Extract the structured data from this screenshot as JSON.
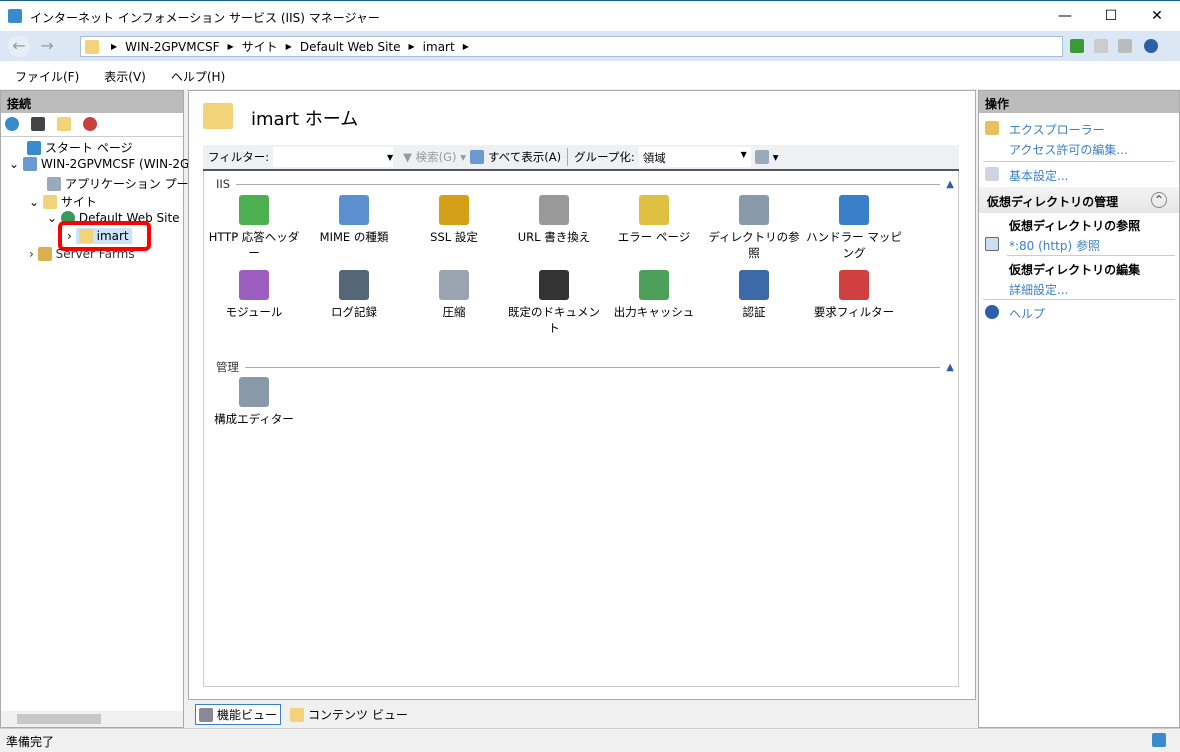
{
  "window": {
    "title": "インターネット インフォメーション サービス (IIS) マネージャー",
    "minimize": "—",
    "maximize": "☐",
    "close": "✕"
  },
  "address": {
    "crumbs": [
      "WIN-2GPVMCSF",
      "サイト",
      "Default Web Site",
      "imart"
    ],
    "back": "←",
    "forward": "→"
  },
  "menu": [
    "ファイル(F)",
    "表示(V)",
    "ヘルプ(H)"
  ],
  "connections": {
    "title": "接続",
    "tree": [
      "スタート ページ",
      "WIN-2GPVMCSF (WIN-2G",
      "アプリケーション プール",
      "サイト",
      "Default Web Site",
      "imart",
      "Server Farms"
    ],
    "selected": "imart"
  },
  "main": {
    "title": "imart ホーム",
    "filter_label": "フィルター:",
    "filter_value": "",
    "search": "検索(G)",
    "show_all": "すべて表示(A)",
    "group_label": "グループ化:",
    "group_value": "領域",
    "sections": [
      {
        "name": "IIS",
        "features": [
          {
            "label": "HTTP 応答ヘッダー",
            "icon": "http-headers-icon",
            "color": "#4caf50"
          },
          {
            "label": "MIME の種類",
            "icon": "mime-types-icon",
            "color": "#5b8fd0"
          },
          {
            "label": "SSL 設定",
            "icon": "lock-icon",
            "color": "#d4a017"
          },
          {
            "label": "URL 書き換え",
            "icon": "url-rewrite-icon",
            "color": "#999999"
          },
          {
            "label": "エラー ページ",
            "icon": "error-pages-icon",
            "color": "#e0c040"
          },
          {
            "label": "ディレクトリの参照",
            "icon": "directory-browsing-icon",
            "color": "#8899aa"
          },
          {
            "label": "ハンドラー マッピング",
            "icon": "handler-mappings-icon",
            "color": "#3a80c8"
          },
          {
            "label": "モジュール",
            "icon": "modules-icon",
            "color": "#9c5fc0"
          },
          {
            "label": "ログ記録",
            "icon": "logging-icon",
            "color": "#556677"
          },
          {
            "label": "圧縮",
            "icon": "compression-icon",
            "color": "#9aa4b0"
          },
          {
            "label": "既定のドキュメント",
            "icon": "default-document-icon",
            "color": "#333333"
          },
          {
            "label": "出力キャッシュ",
            "icon": "output-caching-icon",
            "color": "#4ca05a"
          },
          {
            "label": "認証",
            "icon": "authentication-icon",
            "color": "#3c6aa8"
          },
          {
            "label": "要求フィルター",
            "icon": "request-filtering-icon",
            "color": "#d04040"
          }
        ]
      },
      {
        "name": "管理",
        "features": [
          {
            "label": "構成エディター",
            "icon": "configuration-editor-icon",
            "color": "#8899aa"
          }
        ]
      }
    ]
  },
  "tabs": {
    "features": "機能ビュー",
    "content": "コンテンツ ビュー"
  },
  "actions": {
    "title": "操作",
    "explore": "エクスプローラー",
    "edit_permissions": "アクセス許可の編集...",
    "basic_settings": "基本設定...",
    "manage_vdir": "仮想ディレクトリの管理",
    "browse_vdir": "仮想ディレクトリの参照",
    "browse_link": "*:80 (http) 参照",
    "edit_vdir": "仮想ディレクトリの編集",
    "advanced": "詳細設定...",
    "help": "ヘルプ"
  },
  "status": "準備完了",
  "colors": {
    "highlight": "#ff0000",
    "link": "#3a7fc8",
    "selection": "#cce4f7"
  }
}
